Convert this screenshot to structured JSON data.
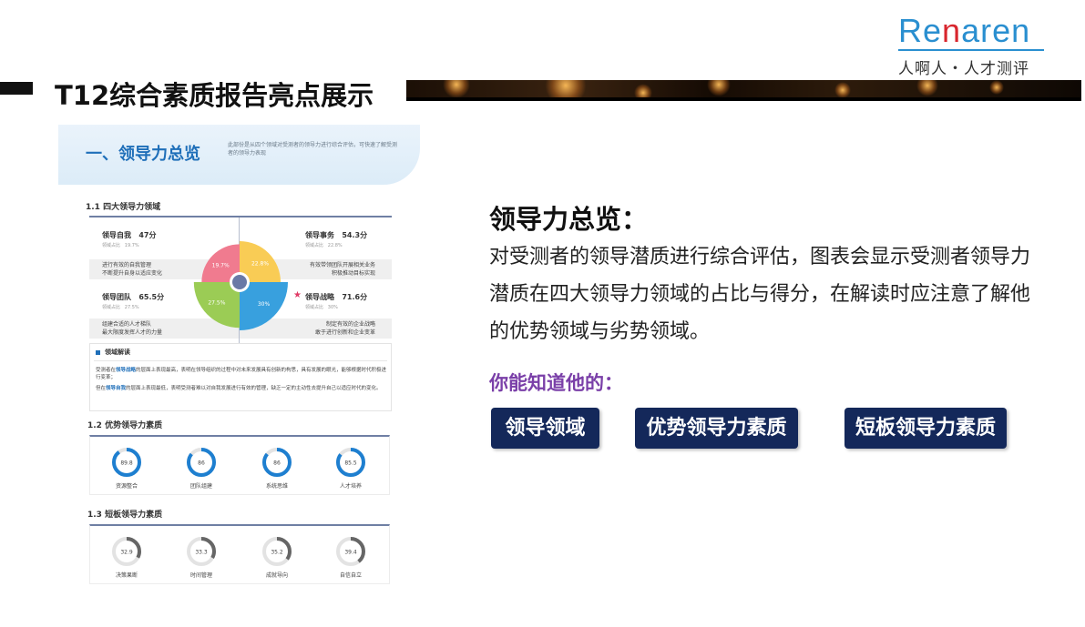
{
  "logo": {
    "en_part1": "Re",
    "en_red": "n",
    "en_part2": "aren",
    "cn": "人啊人・人才测评"
  },
  "page_title": "T12综合素质报告亮点展示",
  "preview": {
    "header_title": "一、领导力总览",
    "header_desc": "此部份是从四个领域对受测者的领导力进行综合评估，可快速了解受测者的领导力表现",
    "sec1_label": "1.1 四大领导力领域",
    "quadrants": [
      {
        "name": "领导自我",
        "score": "47分",
        "share_label": "领域占比",
        "share": "19.7%",
        "desc": [
          "进行有效的自我管理",
          "不断提升自身以适应变化"
        ],
        "color": "#f07b8f"
      },
      {
        "name": "领导事务",
        "score": "54.3分",
        "share_label": "领域占比",
        "share": "22.8%",
        "desc": [
          "有效带领团队开展相关业务",
          "积极推动目标实现"
        ],
        "color": "#f9cc55"
      },
      {
        "name": "领导团队",
        "score": "65.5分",
        "share_label": "领域占比",
        "share": "27.5%",
        "desc": [
          "组建合适的人才梯队",
          "最大限度发挥人才的力量"
        ],
        "color": "#9bcc55"
      },
      {
        "name": "领导战略",
        "score": "71.6分",
        "share_label": "领域占比",
        "share": "30%",
        "desc": [
          "制定有效的企业战略",
          "敢于进行创新和企业变革"
        ],
        "color": "#38a0de"
      }
    ],
    "interp": {
      "head": "领域解读",
      "p1_a": "受测者在",
      "p1_hl": "领导战略",
      "p1_b": "的层面上表现最高，表明在领导组织的过程中对未来发展具有创新的构思，具有发展的眼光，能够根据时代积极进行变革；",
      "p2_a": "但在",
      "p2_hl": "领导自我",
      "p2_b": "的层面上表现最低，表明受测者难以对自我发展进行有效的管理，缺乏一定的主动性去提升自己以适应时代的变化。"
    },
    "sec2_label": "1.2 优势领导力素质",
    "strengths": [
      {
        "label": "资源整合",
        "value": 89.8
      },
      {
        "label": "团队组建",
        "value": 86
      },
      {
        "label": "系统思维",
        "value": 86
      },
      {
        "label": "人才培养",
        "value": 85.5
      }
    ],
    "sec3_label": "1.3 短板领导力素质",
    "weaknesses": [
      {
        "label": "决策果断",
        "value": 32.9
      },
      {
        "label": "时间管理",
        "value": 33.3
      },
      {
        "label": "成就导向",
        "value": 35.2
      },
      {
        "label": "自信自立",
        "value": 39.4
      }
    ],
    "colors": {
      "strength_ring": "#1e7fd0",
      "weak_ring": "#666666",
      "ring_track": "#e3e3e3"
    }
  },
  "right": {
    "heading": "领导力总览：",
    "body": "对受测者的领导潜质进行综合评估，图表会显示受测者领导力潜质在四大领导力领域的占比与得分，在解读时应注意了解他的优势领域与劣势领域。",
    "sub": "你能知道他的：",
    "pills": [
      "领导领域",
      "优势领导力素质",
      "短板领导力素质"
    ]
  }
}
